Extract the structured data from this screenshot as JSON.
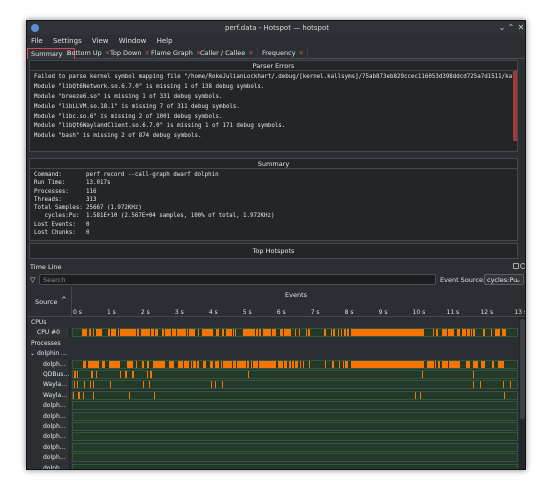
{
  "window": {
    "title": "perf.data - Hotspot — hotspot"
  },
  "menu": [
    "File",
    "Settings",
    "View",
    "Window",
    "Help"
  ],
  "tabs": [
    "Summary",
    "Bottom Up",
    "Top Down",
    "Flame Graph",
    "Caller / Callee",
    "Frequency"
  ],
  "parser_errors": {
    "title": "Parser Errors",
    "lines": [
      "Failed to parse kernel symbol mapping file \"/home/RokeJulianLockhart/.debug/[kernel.kallsyms]/75ab873eb829ccec116053d398ddcd725a7d1511/kallsyms\": Mapp…",
      "Module \"libQt6Network.so.6.7.0\" is missing 1 of 138 debug symbols.",
      "Module \"breeze6.so\" is missing 1 of 331 debug symbols.",
      "Module \"libLLVM.so.18.1\" is missing 7 of 311 debug symbols.",
      "Module \"libc.so.6\" is missing 2 of 1001 debug symbols.",
      "Module \"libQt6WaylandClient.so.6.7.0\" is missing 1 of 171 debug symbols.",
      "Module \"bash\" is missing 2 of 874 debug symbols."
    ]
  },
  "summary": {
    "title": "Summary",
    "rows": [
      {
        "key": "Command:",
        "value": "perf record --call-graph dwarf dolphin"
      },
      {
        "key": "Run Time:",
        "value": "13.017s"
      },
      {
        "key": "Processes:",
        "value": "116"
      },
      {
        "key": "Threads:",
        "value": "313"
      },
      {
        "key": "Total Samples:",
        "value": "25667 (1.972KHz)"
      },
      {
        "key": "   cycles:Pu:",
        "value": "1.581E+10 (2.567E+04 samples, 100% of total, 1.972KHz)"
      },
      {
        "key": "Lost Events:",
        "value": "0"
      },
      {
        "key": "Lost Chunks:",
        "value": "0"
      }
    ]
  },
  "top_hotspots": {
    "title": "Top Hotspots"
  },
  "timeline": {
    "title": "Time Line",
    "search_placeholder": "Search",
    "event_source_label": "Event Source:",
    "event_source_value": "cycles:Pu",
    "source_header": "Source",
    "events_header": "Events",
    "ticks": [
      "0 s",
      "1 s",
      "2 s",
      "3 s",
      "4 s",
      "5 s",
      "6 s",
      "7 s",
      "8 s",
      "9 s",
      "10 s",
      "11 s",
      "12 s",
      "13 s"
    ],
    "rows": [
      {
        "label": "CPUs",
        "indent": 0,
        "kind": "group"
      },
      {
        "label": "CPU #0",
        "indent": 1,
        "kind": "cpu"
      },
      {
        "label": "Processes",
        "indent": 0,
        "kind": "group"
      },
      {
        "label": "dolphin …",
        "indent": 1,
        "kind": "group"
      },
      {
        "label": "dolph…",
        "indent": 2,
        "kind": "dense"
      },
      {
        "label": "QDBus…",
        "indent": 2,
        "kind": "sparse"
      },
      {
        "label": "Wayla…",
        "indent": 2,
        "kind": "sparse"
      },
      {
        "label": "Wayla…",
        "indent": 2,
        "kind": "sparse"
      },
      {
        "label": "dolph…",
        "indent": 2,
        "kind": "empty"
      },
      {
        "label": "dolph…",
        "indent": 2,
        "kind": "empty"
      },
      {
        "label": "dolph…",
        "indent": 2,
        "kind": "empty"
      },
      {
        "label": "dolph…",
        "indent": 2,
        "kind": "empty"
      },
      {
        "label": "dolph…",
        "indent": 2,
        "kind": "empty"
      },
      {
        "label": "dolph…",
        "indent": 2,
        "kind": "empty"
      },
      {
        "label": "dolph…",
        "indent": 2,
        "kind": "empty"
      }
    ]
  },
  "colors": {
    "accent": "#da4453",
    "event": "#f67400",
    "track": "#233a2a"
  }
}
